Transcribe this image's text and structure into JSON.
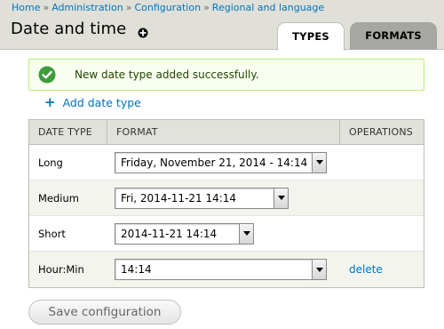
{
  "breadcrumb": [
    "Home",
    "Administration",
    "Configuration",
    "Regional and language"
  ],
  "breadcrumb_separator": "»",
  "page": {
    "title": "Date and time"
  },
  "tabs": [
    {
      "label": "TYPES",
      "active": true
    },
    {
      "label": "FORMATS",
      "active": false
    }
  ],
  "message": {
    "text": "New date type added successfully.",
    "status": "success",
    "icon": "check-circle-icon",
    "color": "#3e9b3d"
  },
  "actions": {
    "add_label": "Add date type",
    "icon": "plus-icon"
  },
  "table": {
    "headers": [
      "DATE TYPE",
      "FORMAT",
      "OPERATIONS"
    ],
    "rows": [
      {
        "type": "Long",
        "format": "Friday, November 21, 2014 - 14:14",
        "operation": ""
      },
      {
        "type": "Medium",
        "format": "Fri, 2014-11-21 14:14",
        "operation": ""
      },
      {
        "type": "Short",
        "format": "2014-11-21 14:14",
        "operation": ""
      },
      {
        "type": "Hour:Min",
        "format": "14:14",
        "operation": "delete"
      }
    ]
  },
  "form": {
    "submit_label": "Save configuration"
  },
  "colors": {
    "link": "#0074bd",
    "header_bg": "#e0e0d8",
    "success_bg": "#f8fff0"
  }
}
